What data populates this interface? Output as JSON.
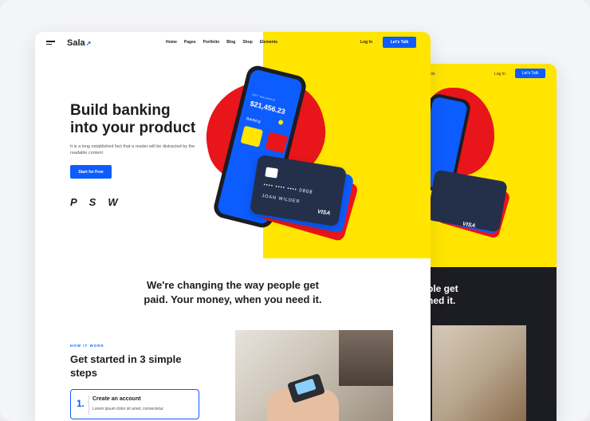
{
  "back_page": {
    "nav_fragment": "ents",
    "login": "Log In",
    "talk": "Let's Talk",
    "tagline_fragment_1": "ple get",
    "tagline_fragment_2": "ned it.",
    "card_brand": "VISA"
  },
  "header": {
    "logo": "Sala",
    "nav": [
      "Home",
      "Pages",
      "Portfolio",
      "Blog",
      "Shop",
      "Elements"
    ],
    "login": "Log In",
    "talk": "Let's Talk"
  },
  "hero": {
    "headline_1": "Build banking",
    "headline_2": "into your product",
    "subtext": "It is a long established fact that a reader will be distracted by the readable content",
    "cta": "Start for Free",
    "partners": [
      "P",
      "S",
      "W"
    ]
  },
  "phone": {
    "balance_label": "NET BALANCE",
    "balance": "$21,456.23",
    "section": "Banking"
  },
  "card": {
    "number": "•••• •••• •••• 0808",
    "holder": "JOAN WILDER",
    "brand": "VISA"
  },
  "tagline": {
    "line1": "We're changing the way people get",
    "line2": "paid. Your money, when you need it."
  },
  "how": {
    "label": "HOW IT WORK",
    "title": "Get started in 3 simple steps",
    "step": {
      "number": "1.",
      "title": "Create an account",
      "text": "Lorem ipsum dolor sit amet, consectetur"
    }
  },
  "colors": {
    "brand_blue": "#0d5cff",
    "yellow": "#ffe500",
    "red": "#e8151a",
    "dark": "#1c1d22"
  }
}
